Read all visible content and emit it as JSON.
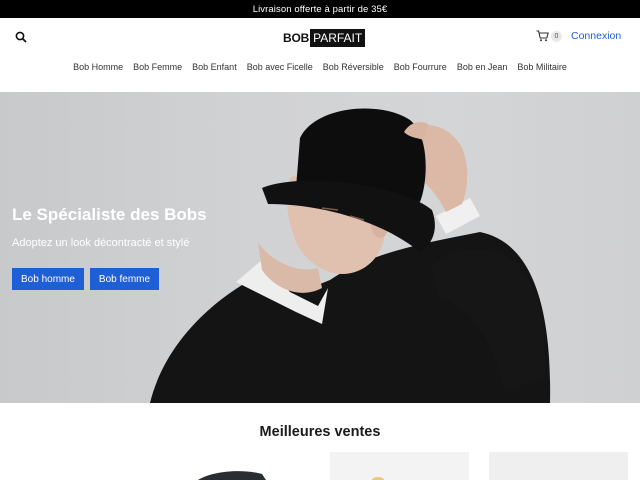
{
  "announcement": "Livraison offerte à partir de 35€",
  "header": {
    "logo_part1": "BOB",
    "logo_part2": "PARFAIT",
    "cart_count": "0",
    "login_label": "Connexion"
  },
  "nav": {
    "items": [
      {
        "label": "Bob Homme"
      },
      {
        "label": "Bob Femme"
      },
      {
        "label": "Bob Enfant"
      },
      {
        "label": "Bob avec Ficelle"
      },
      {
        "label": "Bob Réversible"
      },
      {
        "label": "Bob Fourrure"
      },
      {
        "label": "Bob en Jean"
      },
      {
        "label": "Bob Militaire"
      }
    ]
  },
  "hero": {
    "title": "Le Spécialiste des Bobs",
    "subtitle": "Adoptez un look décontracté et stylé",
    "button_1": "Bob homme",
    "button_2": "Bob femme"
  },
  "section": {
    "title": "Meilleures ventes"
  },
  "colors": {
    "accent": "#1f5fd6",
    "link": "#1e5ed6",
    "announcement_bg": "#000000"
  },
  "icons": {
    "search": "search-icon",
    "cart": "cart-icon"
  }
}
